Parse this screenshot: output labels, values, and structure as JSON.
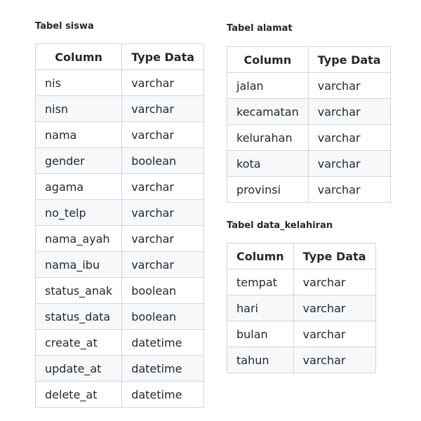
{
  "tables": [
    {
      "title": "Tabel siswa",
      "headers": [
        "Column",
        "Type Data"
      ],
      "rows": [
        [
          "nis",
          "varchar"
        ],
        [
          "nisn",
          "varchar"
        ],
        [
          "nama",
          "varchar"
        ],
        [
          "gender",
          "boolean"
        ],
        [
          "agama",
          "varchar"
        ],
        [
          "no_telp",
          "varchar"
        ],
        [
          "nama_ayah",
          "varchar"
        ],
        [
          "nama_ibu",
          "varchar"
        ],
        [
          "status_anak",
          "boolean"
        ],
        [
          "status_data",
          "boolean"
        ],
        [
          "create_at",
          "datetime"
        ],
        [
          "update_at",
          "datetime"
        ],
        [
          "delete_at",
          "datetime"
        ]
      ]
    },
    {
      "title": "Tabel alamat",
      "headers": [
        "Column",
        "Type Data"
      ],
      "rows": [
        [
          "jalan",
          "varchar"
        ],
        [
          "kecamatan",
          "varchar"
        ],
        [
          "kelurahan",
          "varchar"
        ],
        [
          "kota",
          "varchar"
        ],
        [
          "provinsi",
          "varchar"
        ]
      ]
    },
    {
      "title": "Tabel data_kelahiran",
      "headers": [
        "Column",
        "Type Data"
      ],
      "rows": [
        [
          "tempat",
          "varchar"
        ],
        [
          "hari",
          "varchar"
        ],
        [
          "bulan",
          "varchar"
        ],
        [
          "tahun",
          "varchar"
        ]
      ]
    }
  ]
}
